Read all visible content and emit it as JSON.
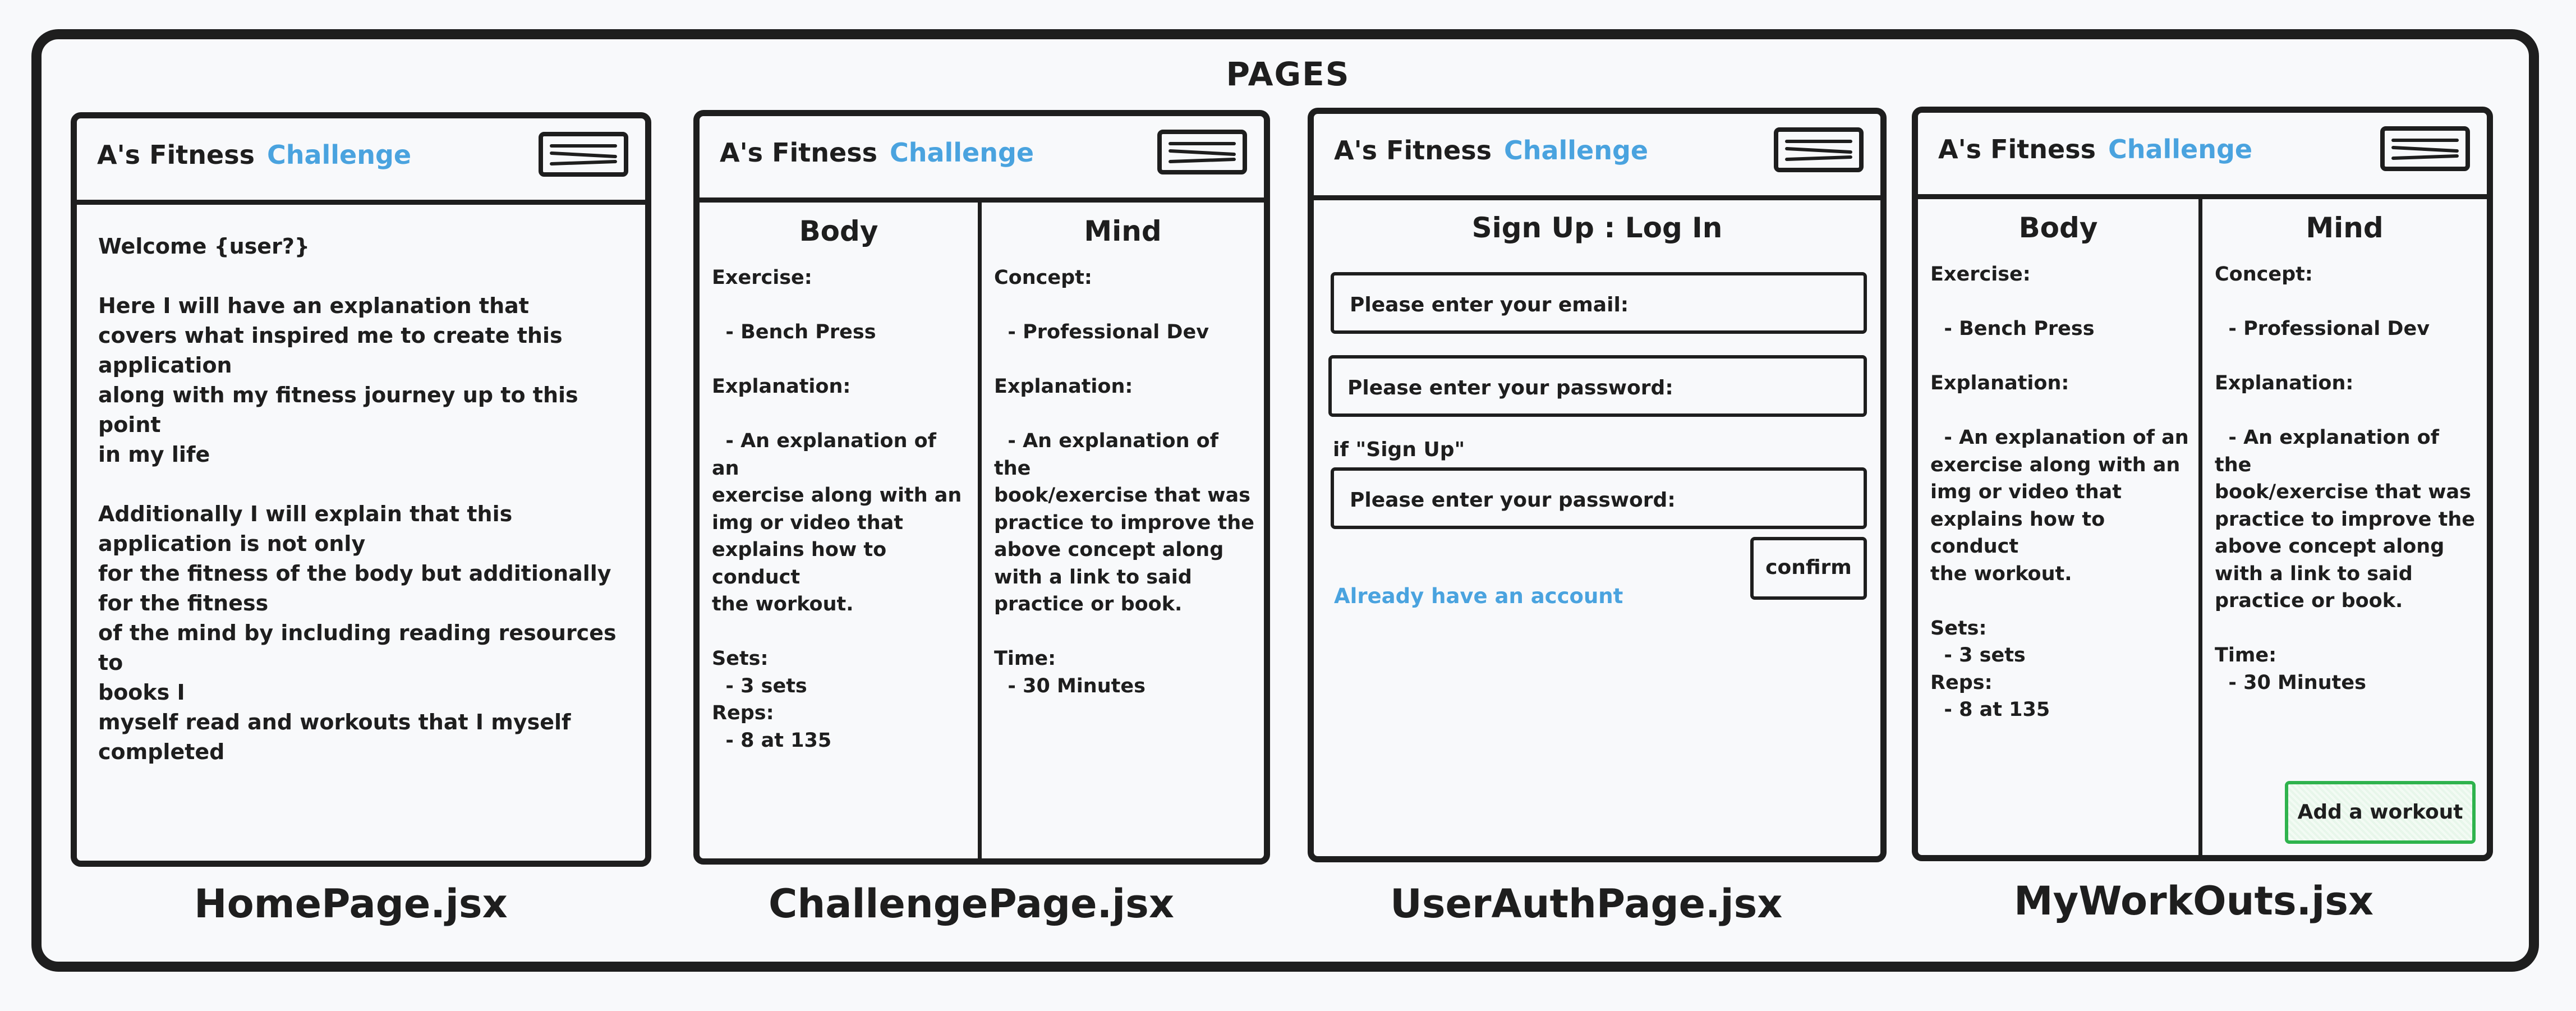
{
  "heading": "PAGES",
  "app": {
    "name": "A's Fitness",
    "accent": "Challenge",
    "accent_color": "#4aa3df",
    "menu_icon": "hamburger-menu-icon"
  },
  "captions": [
    "HomePage.jsx",
    "ChallengePage.jsx",
    "UserAuthPage.jsx",
    "MyWorkOuts.jsx"
  ],
  "home": {
    "text": "Welcome {user?}\n\nHere I will have an explanation that\ncovers what inspired me to create this\napplication\nalong with my fitness journey up to this point\nin my life\n\nAdditionally I will explain that this\napplication is not only\nfor the fitness of the body but additionally\nfor the fitness\nof the mind by including reading resources to\nbooks I\nmyself read and workouts that I myself\ncompleted"
  },
  "challenge": {
    "body_title": "Body",
    "body_text": "Exercise:\n\n  - Bench Press\n\nExplanation:\n\n  - An explanation of an\nexercise along with an\nimg or video that\nexplains how to conduct\nthe workout.\n\nSets:\n  - 3 sets\nReps:\n  - 8 at 135",
    "mind_title": "Mind",
    "mind_text": "Concept:\n\n  - Professional Dev\n\nExplanation:\n\n  - An explanation of the\nbook/exercise that was\npractice to improve the\nabove concept along\nwith a link to said\npractice or book.\n\nTime:\n  - 30 Minutes"
  },
  "auth": {
    "title": "Sign Up : Log In",
    "email_placeholder": "Please enter your email:",
    "password_placeholder": "Please enter your password:",
    "if_signup": "if \"Sign Up\"",
    "confirm_password_placeholder": "Please enter your password:",
    "confirm_label": "confirm",
    "link_label": "Already have an account"
  },
  "workouts": {
    "add_label": "Add a workout",
    "add_color": "#2fb34d"
  }
}
